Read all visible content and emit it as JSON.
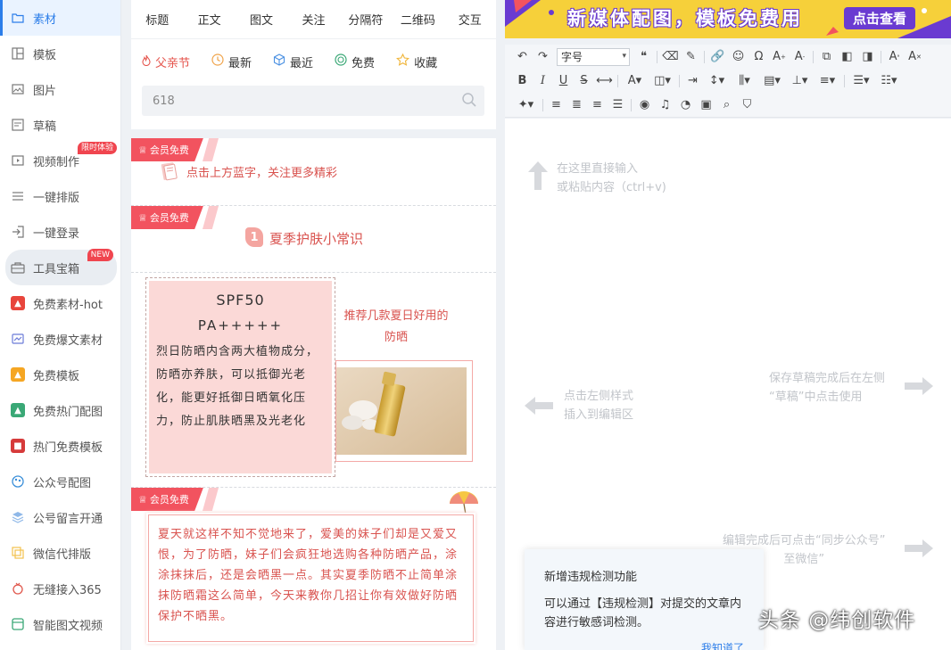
{
  "sidebar": {
    "items": [
      {
        "label": "素材",
        "icon": "folder-icon"
      },
      {
        "label": "模板",
        "icon": "template-icon"
      },
      {
        "label": "图片",
        "icon": "image-icon"
      },
      {
        "label": "草稿",
        "icon": "draft-icon"
      },
      {
        "label": "视频制作",
        "icon": "video-icon",
        "badge": "限时体验"
      },
      {
        "label": "一键排版",
        "icon": "list-icon"
      },
      {
        "label": "一键登录",
        "icon": "login-icon"
      },
      {
        "label": "工具宝箱",
        "icon": "toolbox-icon",
        "badge": "NEW"
      },
      {
        "label": "免费素材-hot",
        "icon": "hot-material-icon"
      },
      {
        "label": "免费爆文素材",
        "icon": "chart-icon"
      },
      {
        "label": "免费模板",
        "icon": "free-template-icon"
      },
      {
        "label": "免费热门配图",
        "icon": "photo-icon"
      },
      {
        "label": "热门免费模板",
        "icon": "hot-template-icon"
      },
      {
        "label": "公众号配图",
        "icon": "palette-icon"
      },
      {
        "label": "公号留言开通",
        "icon": "layers-icon"
      },
      {
        "label": "微信代排版",
        "icon": "typeset-icon"
      },
      {
        "label": "无缝接入365",
        "icon": "plugin-icon"
      },
      {
        "label": "智能图文视频",
        "icon": "smart-video-icon"
      }
    ]
  },
  "material": {
    "tabs": [
      "标题",
      "正文",
      "图文",
      "关注",
      "分隔符",
      "二维码",
      "交互"
    ],
    "filters": [
      {
        "label": "父亲节",
        "icon": "flame-icon"
      },
      {
        "label": "最新",
        "icon": "clock-icon"
      },
      {
        "label": "最近",
        "icon": "cube-icon"
      },
      {
        "label": "免费",
        "icon": "coin-icon"
      },
      {
        "label": "收藏",
        "icon": "star-icon"
      }
    ],
    "search_value": "618"
  },
  "cards": {
    "tag_label": "会员免费",
    "card1_text": "点击上方蓝字，关注更多精彩",
    "card2_number": "1",
    "card2_title": "夏季护肤小常识",
    "spf_title": "SPF50",
    "spf_sub": "PA+++++",
    "spf_body": "烈日防晒内含两大植物成分，防晒亦养肤，可以抵御光老化，能更好抵御日晒氧化压力，防止肌肤晒黑及光老化",
    "recommend_text": "推荐几款夏日好用的防晒",
    "summer_text": "夏天就这样不知不觉地来了，爱美的妹子们却是又爱又恨，为了防晒，妹子们会疯狂地选购各种防晒产品，涂涂抹抹后，还是会晒黑一点。其实夏季防晒不止简单涂抹防晒霜这么简单，今天来教你几招让你有效做好防晒保护不晒黑。"
  },
  "banner": {
    "text": "新媒体配图，模板免费用",
    "button": "点击查看"
  },
  "toolbar": {
    "font_size_label": "字号"
  },
  "editor": {
    "hint_top_1": "在这里直接输入",
    "hint_top_2": "或粘贴内容（ctrl+v)",
    "hint_left_1": "点击左侧样式",
    "hint_left_2": "插入到编辑区",
    "hint_right_1": "保存草稿完成后在左侧",
    "hint_right_2": "“草稿”中点击使用",
    "hint_sync_1": "编辑完成后可点击“同步公众号”",
    "hint_sync_2": "至微信”"
  },
  "notice": {
    "title": "新增违规检测功能",
    "body": "可以通过【违规检测】对提交的文章内容进行敏感词检测。",
    "link": "我知道了"
  },
  "watermark": "头条 @纬创软件",
  "colors": {
    "accent": "#2b7de9",
    "tag_red": "#f2535f",
    "text_red": "#d9534f",
    "spf_bg": "#fbd9d7",
    "banner_yellow": "#f6d03a",
    "banner_purple": "#6a3bd1"
  }
}
